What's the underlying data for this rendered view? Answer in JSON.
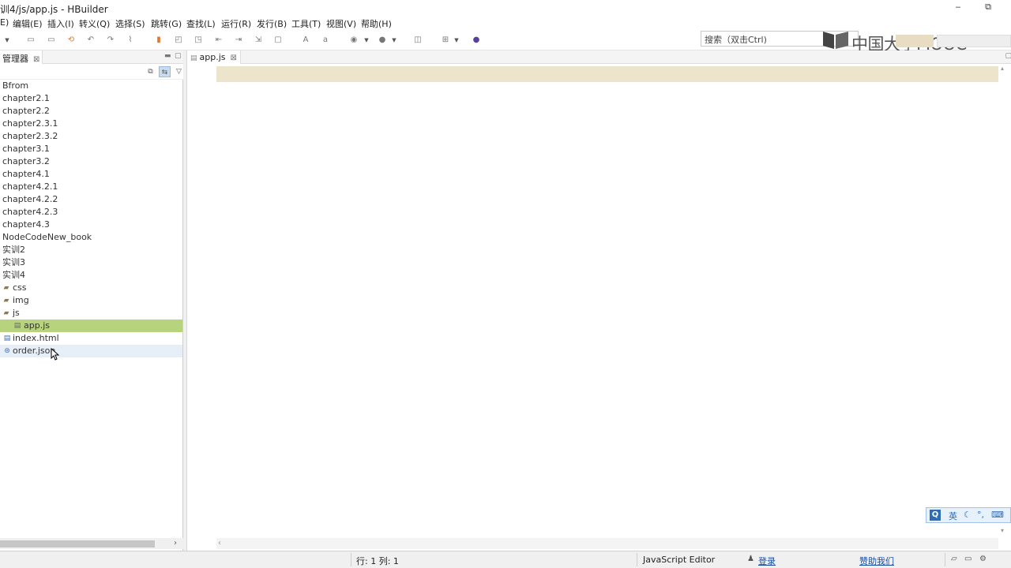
{
  "window": {
    "title": "训4/js/app.js  -  HBuilder",
    "minimize_glyph": "‒",
    "restore_glyph": "⧉"
  },
  "menu": {
    "items": [
      {
        "label": "E)"
      },
      {
        "label": "编辑(E)"
      },
      {
        "label": "插入(I)"
      },
      {
        "label": "转义(Q)"
      },
      {
        "label": "选择(S)"
      },
      {
        "label": "跳转(G)"
      },
      {
        "label": "查找(L)"
      },
      {
        "label": "运行(R)"
      },
      {
        "label": "发行(B)"
      },
      {
        "label": "工具(T)"
      },
      {
        "label": "视图(V)"
      },
      {
        "label": "帮助(H)"
      }
    ]
  },
  "toolbar": {
    "search_placeholder": "搜索（双击Ctrl)",
    "logo_text": "中国大学MOOC"
  },
  "explorer": {
    "tab_label": "管理器",
    "close_glyph": "⊠",
    "items": [
      {
        "label": "Bfrom",
        "type": "project"
      },
      {
        "label": "chapter2.1",
        "type": "project"
      },
      {
        "label": "chapter2.2",
        "type": "project"
      },
      {
        "label": "chapter2.3.1",
        "type": "project"
      },
      {
        "label": "chapter2.3.2",
        "type": "project"
      },
      {
        "label": "chapter3.1",
        "type": "project"
      },
      {
        "label": "chapter3.2",
        "type": "project"
      },
      {
        "label": "chapter4.1",
        "type": "project"
      },
      {
        "label": "chapter4.2.1",
        "type": "project"
      },
      {
        "label": "chapter4.2.2",
        "type": "project"
      },
      {
        "label": "chapter4.2.3",
        "type": "project"
      },
      {
        "label": "chapter4.3",
        "type": "project"
      },
      {
        "label": "NodeCodeNew_book",
        "type": "project"
      },
      {
        "label": "实训2",
        "type": "project"
      },
      {
        "label": "实训3",
        "type": "project"
      },
      {
        "label": "实训4",
        "type": "project"
      },
      {
        "label": "css",
        "type": "folder"
      },
      {
        "label": "img",
        "type": "folder"
      },
      {
        "label": "js",
        "type": "folder-open"
      },
      {
        "label": "app.js",
        "type": "file-js",
        "state": "selected"
      },
      {
        "label": "index.html",
        "type": "file-html"
      },
      {
        "label": "order.json",
        "type": "file-json",
        "state": "hover"
      }
    ]
  },
  "editor": {
    "tab_label": "app.js",
    "close_glyph": "⊠",
    "cursor_line": 1
  },
  "ime": {
    "q": "Q",
    "lang": "英",
    "moon": "☾",
    "punct": "°,",
    "kb": "⌨"
  },
  "status": {
    "position": "行: 1 列: 1",
    "editor_type": "JavaScript Editor",
    "login": "登录",
    "help_us": "赞助我们"
  },
  "colors": {
    "selected_row": "#b7d37e",
    "current_line": "#ede4cc",
    "link": "#1a4fa0"
  }
}
